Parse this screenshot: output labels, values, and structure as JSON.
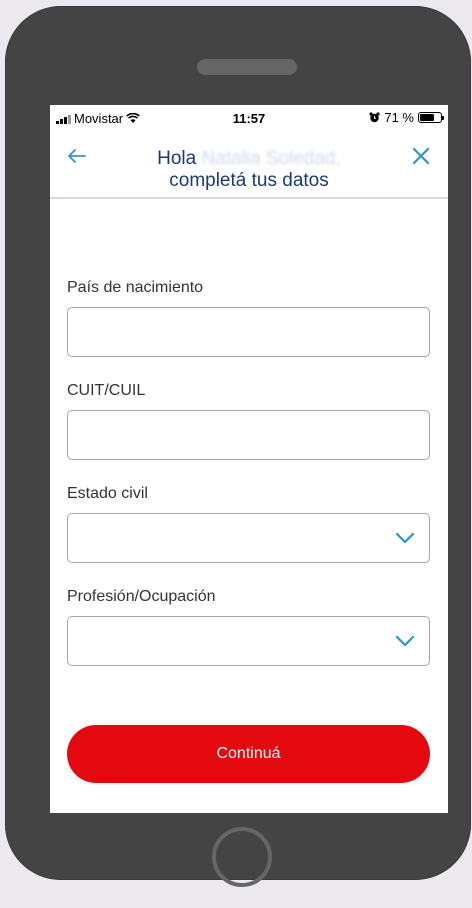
{
  "status_bar": {
    "carrier": "Movistar",
    "time": "11:57",
    "battery_percent": "71 %",
    "battery_level": 0.71
  },
  "header": {
    "greeting": "Hola",
    "name_obscured": "Natalia Soledad,",
    "subtitle": "completá tus datos",
    "back_icon": "arrow-left-icon",
    "close_icon": "close-icon",
    "accent_color": "#2b93d6",
    "title_color": "#1b3a74"
  },
  "form": {
    "fields": [
      {
        "label": "País de nacimiento",
        "value": "",
        "type": "text"
      },
      {
        "label": "CUIT/CUIL",
        "value": "",
        "type": "text"
      },
      {
        "label": "Estado civil",
        "value": "",
        "type": "select"
      },
      {
        "label": "Profesión/Ocupación",
        "value": "",
        "type": "select"
      }
    ]
  },
  "actions": {
    "continue_label": "Continuá",
    "continue_color": "#e4080f"
  }
}
